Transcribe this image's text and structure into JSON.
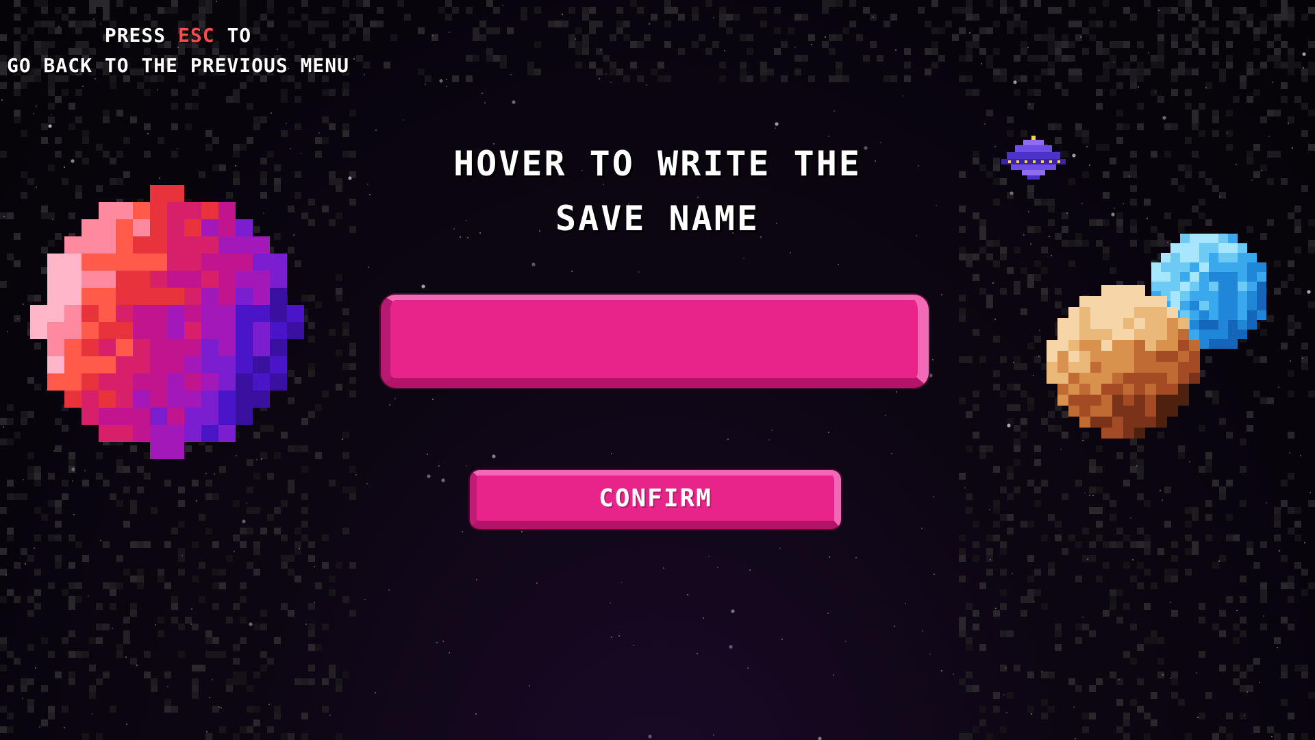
{
  "hint": {
    "line1_before": "PRESS",
    "line1_key": "ESC",
    "line1_after": "TO",
    "line2": "GO BACK TO THE PREVIOUS MENU"
  },
  "title": {
    "line1": "HOVER TO WRITE THE",
    "line2": "SAVE NAME"
  },
  "save_name_input": {
    "value": "",
    "placeholder": ""
  },
  "confirm_button": {
    "label": "CONFIRM"
  },
  "colors": {
    "accent": "#e8248a",
    "esc_key": "#ff4b4b",
    "background": "#0c0612"
  },
  "icons": {
    "left_planet": "red-purple-planet-icon",
    "right_planets": "orange-and-blue-planets-icon",
    "ship": "ufo-icon"
  }
}
